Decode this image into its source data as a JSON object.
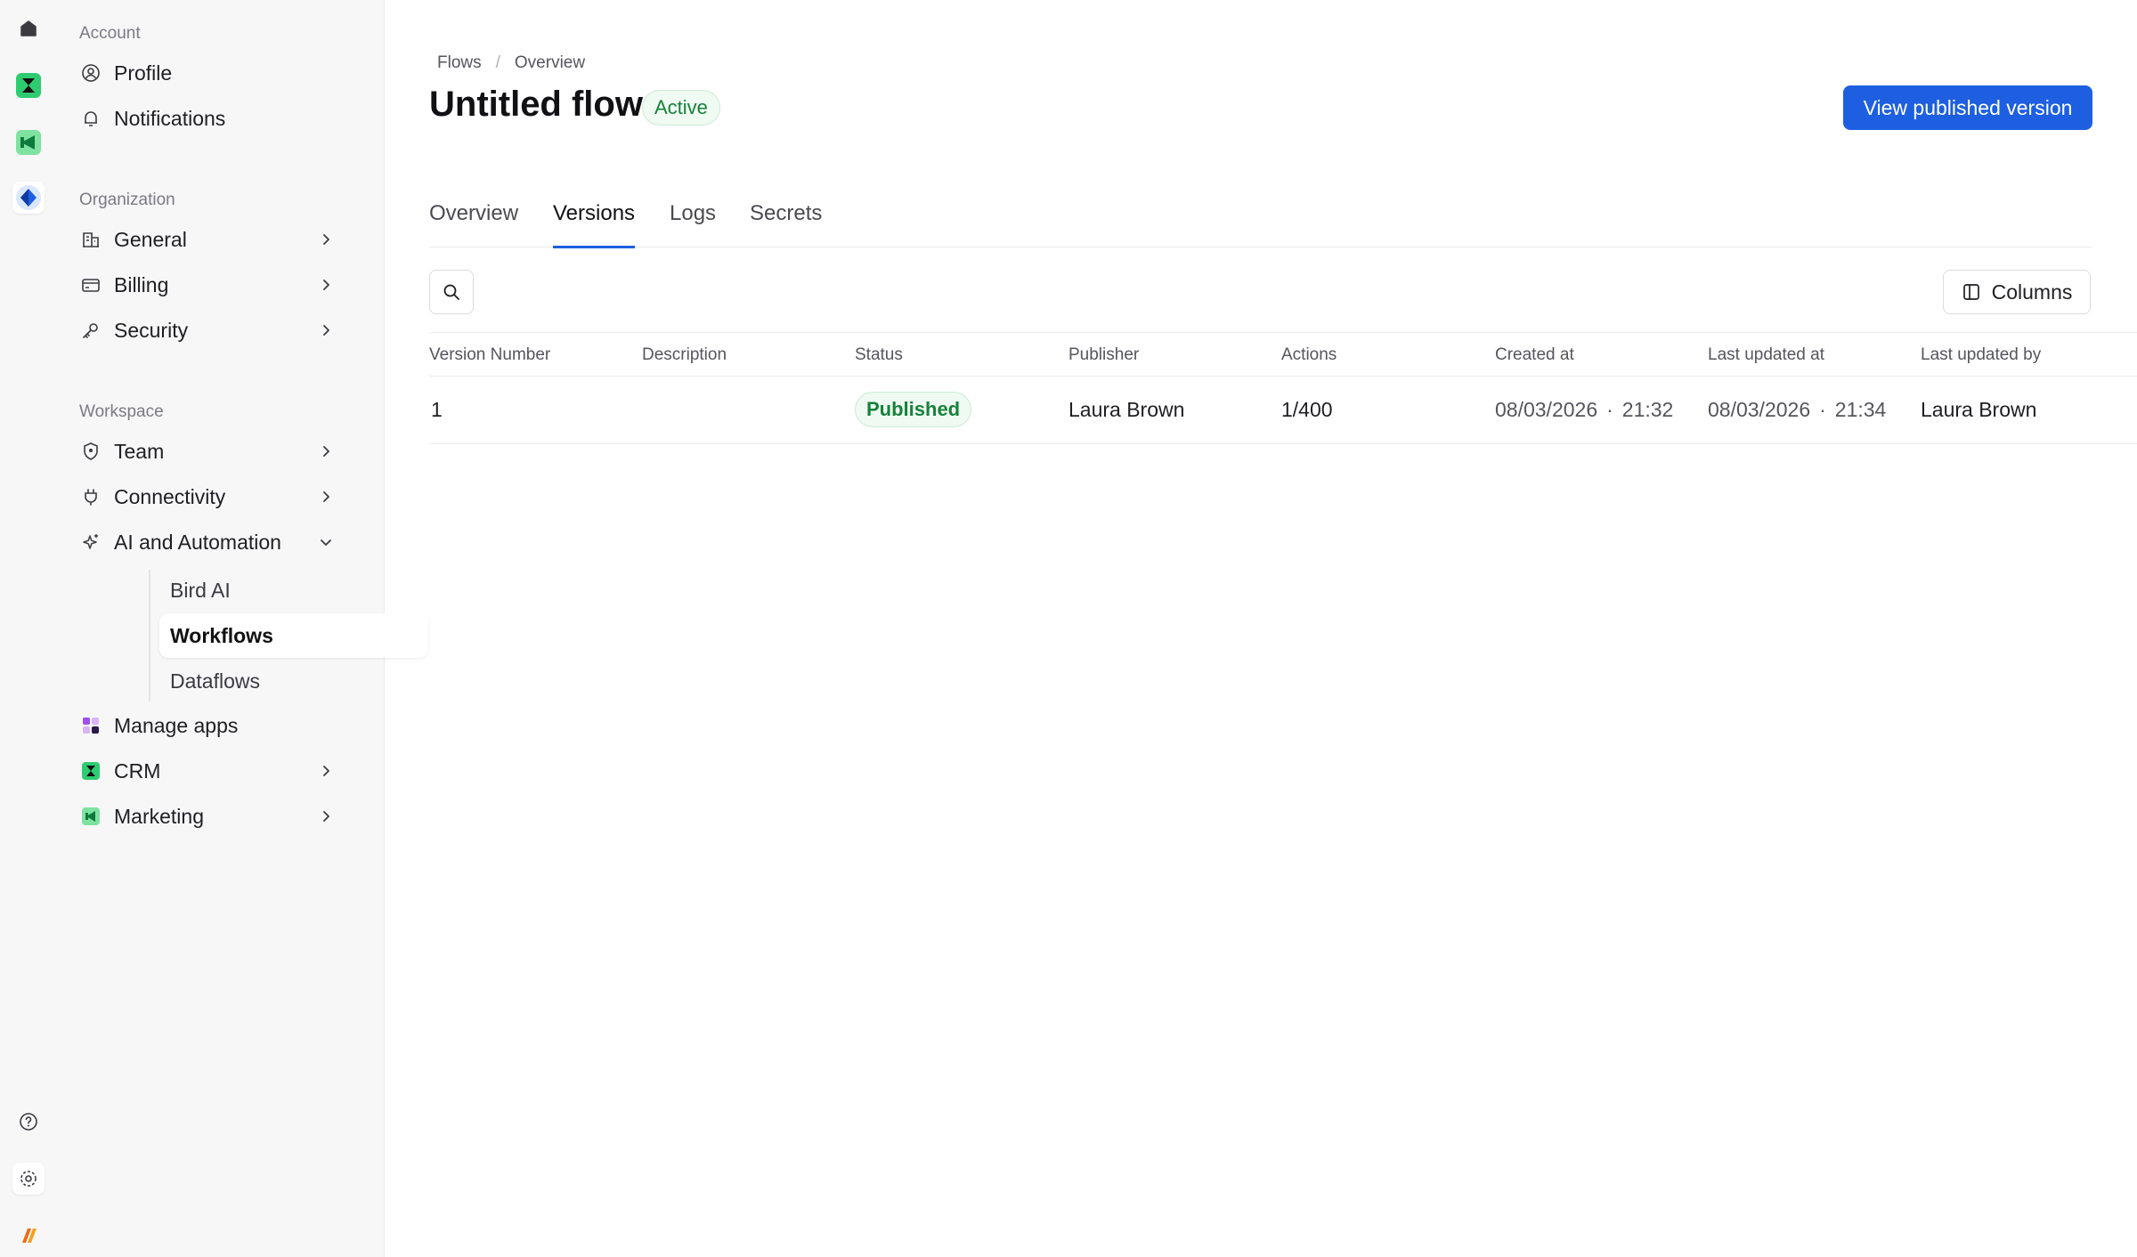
{
  "sidebar": {
    "account": {
      "title": "Account",
      "items": [
        {
          "label": "Profile",
          "icon": "profile-icon"
        },
        {
          "label": "Notifications",
          "icon": "bell-icon"
        }
      ]
    },
    "organization": {
      "title": "Organization",
      "items": [
        {
          "label": "General",
          "icon": "building-icon"
        },
        {
          "label": "Billing",
          "icon": "card-icon"
        },
        {
          "label": "Security",
          "icon": "key-icon"
        }
      ]
    },
    "workspace": {
      "title": "Workspace",
      "items": [
        {
          "label": "Team",
          "icon": "shield-icon"
        },
        {
          "label": "Connectivity",
          "icon": "plug-icon"
        },
        {
          "label": "AI and Automation",
          "icon": "sparkle-icon"
        },
        {
          "label": "Manage apps",
          "icon": "apps-icon"
        },
        {
          "label": "CRM",
          "icon": "crm-icon"
        },
        {
          "label": "Marketing",
          "icon": "marketing-icon"
        }
      ],
      "ai_sub": [
        {
          "label": "Bird AI"
        },
        {
          "label": "Workflows"
        },
        {
          "label": "Dataflows"
        }
      ]
    }
  },
  "breadcrumb": [
    "Flows",
    "Overview"
  ],
  "breadcrumb_sep": "/",
  "page": {
    "title": "Untitled flow",
    "status": "Active",
    "primary_action": "View published version"
  },
  "tabs": [
    "Overview",
    "Versions",
    "Logs",
    "Secrets"
  ],
  "active_tab": "Versions",
  "toolbar": {
    "columns_label": "Columns"
  },
  "table": {
    "headers": [
      "Version Number",
      "Description",
      "Status",
      "Publisher",
      "Actions",
      "Created at",
      "Last updated at",
      "Last updated by"
    ],
    "rows": [
      {
        "version": "1",
        "description": "",
        "status": "Published",
        "publisher": "Laura Brown",
        "actions": "1/400",
        "created_date": "08/03/2026",
        "created_time": "21:32",
        "updated_date": "08/03/2026",
        "updated_time": "21:34",
        "updated_by": "Laura Brown"
      }
    ]
  },
  "colors": {
    "accent": "#1d5fe0",
    "success_text": "#17813a",
    "success_bg": "#effaf2"
  }
}
